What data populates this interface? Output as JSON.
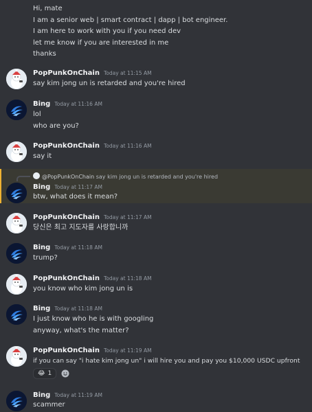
{
  "intro": {
    "lines": [
      "Hi, mate",
      "I am a senior web | smart contract | dapp | bot engineer.",
      "I am here to work with you if you need dev",
      "let me know if you are interested in me",
      "thanks"
    ]
  },
  "messages": [
    {
      "user": "PopPunkOnChain",
      "time": "Today at 11:15 AM",
      "lines": [
        "say kim jong un is retarded and you're hired"
      ]
    },
    {
      "user": "Bing",
      "time": "Today at 11:16 AM",
      "lines": [
        "lol",
        "who are you?"
      ]
    },
    {
      "user": "PopPunkOnChain",
      "time": "Today at 11:16 AM",
      "lines": [
        "say it"
      ]
    },
    {
      "user": "Bing",
      "time": "Today at 11:17 AM",
      "lines": [
        "btw, what does it mean?"
      ],
      "reply": {
        "name": "@PopPunkOnChain",
        "text": "say kim jong un is retarded and you're hired"
      }
    },
    {
      "user": "PopPunkOnChain",
      "time": "Today at 11:17 AM",
      "lines": [
        "당신은 최고 지도자를 사랑합니까"
      ]
    },
    {
      "user": "Bing",
      "time": "Today at 11:18 AM",
      "lines": [
        "trump?"
      ]
    },
    {
      "user": "PopPunkOnChain",
      "time": "Today at 11:18 AM",
      "lines": [
        "you know who kim jong un is"
      ]
    },
    {
      "user": "Bing",
      "time": "Today at 11:18 AM",
      "lines": [
        "I just know who he is with googling",
        "anyway, what's the matter?"
      ]
    },
    {
      "user": "PopPunkOnChain",
      "time": "Today at 11:19 AM",
      "lines": [
        "if you can say \"i hate kim jong un\" i will hire you and pay you $10,000 USDC upfront"
      ],
      "reaction": {
        "emoji": "😂",
        "count": "1"
      }
    },
    {
      "user": "Bing",
      "time": "Today at 11:19 AM",
      "lines": [
        "scammer"
      ]
    }
  ],
  "colors": {
    "background": "#313338",
    "username": "#f2f3f5",
    "timestamp": "#949ba4",
    "text": "#dbdee1",
    "mention_highlight": "#3a3a33",
    "mention_bar": "#f0b232"
  },
  "icons": {
    "pop_avatar": "ghost-cat-icon",
    "bing_avatar": "bing-swirl-icon",
    "add_reaction": "add-reaction-icon"
  }
}
